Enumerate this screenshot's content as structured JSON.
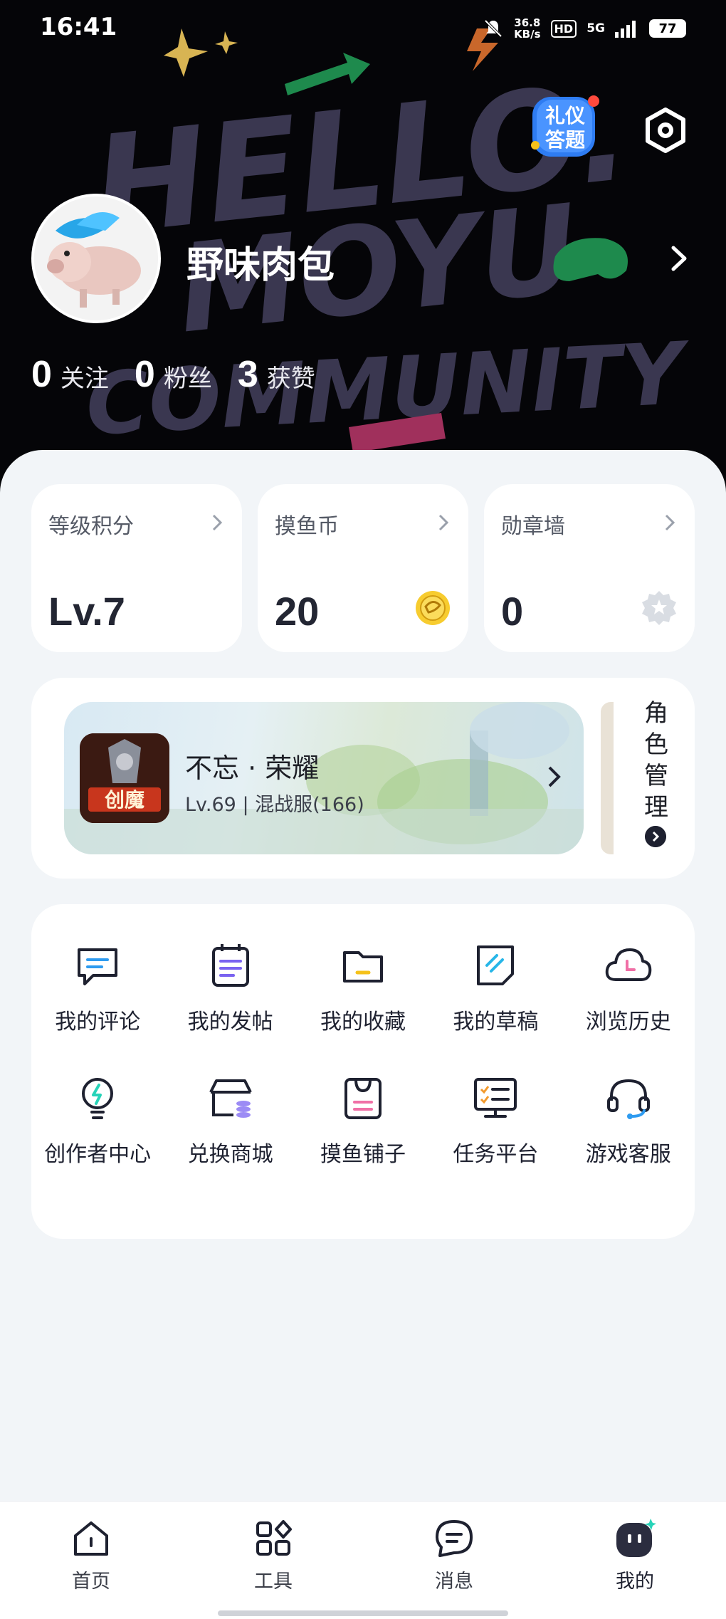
{
  "status_bar": {
    "time": "16:41",
    "net_speed_value": "36.8",
    "net_speed_unit": "KB/s",
    "hd": "HD",
    "network": "5G",
    "battery": "77"
  },
  "header": {
    "background_text": [
      "HELLO.",
      "MOYU",
      "COMMUNITY"
    ],
    "quiz_badge": [
      "礼仪",
      "答题"
    ]
  },
  "profile": {
    "name": "野味肉包",
    "stats": [
      {
        "value": "0",
        "label": "关注"
      },
      {
        "value": "0",
        "label": "粉丝"
      },
      {
        "value": "3",
        "label": "获赞"
      }
    ]
  },
  "cards": [
    {
      "title": "等级积分",
      "value": "Lv.7",
      "icon": "none"
    },
    {
      "title": "摸鱼币",
      "value": "20",
      "icon": "coin-icon"
    },
    {
      "title": "勋章墙",
      "value": "0",
      "icon": "medal-icon"
    }
  ],
  "role": {
    "game_name": "不忘 · 荣耀",
    "game_meta": "Lv.69 | 混战服(166)",
    "game_logo_text": "创魔",
    "manage_label": [
      "角",
      "色",
      "管",
      "理"
    ]
  },
  "menu": [
    {
      "label": "我的评论",
      "icon": "comment-icon"
    },
    {
      "label": "我的发帖",
      "icon": "post-icon"
    },
    {
      "label": "我的收藏",
      "icon": "folder-icon"
    },
    {
      "label": "我的草稿",
      "icon": "draft-icon"
    },
    {
      "label": "浏览历史",
      "icon": "history-icon"
    },
    {
      "label": "创作者中心",
      "icon": "bulb-icon"
    },
    {
      "label": "兑换商城",
      "icon": "shop-icon"
    },
    {
      "label": "摸鱼铺子",
      "icon": "bag-icon"
    },
    {
      "label": "任务平台",
      "icon": "task-icon"
    },
    {
      "label": "游戏客服",
      "icon": "headset-icon"
    }
  ],
  "nav": [
    {
      "label": "首页",
      "icon": "home-icon"
    },
    {
      "label": "工具",
      "icon": "tools-icon"
    },
    {
      "label": "消息",
      "icon": "message-icon"
    },
    {
      "label": "我的",
      "icon": "mine-icon"
    }
  ],
  "colors": {
    "header_bg": "#050508",
    "accent_purple": "#7a63f0",
    "accent_teal": "#27d3b8",
    "accent_yellow": "#f5c21b",
    "accent_pink": "#f06fa6",
    "accent_blue": "#2e9bf0"
  }
}
